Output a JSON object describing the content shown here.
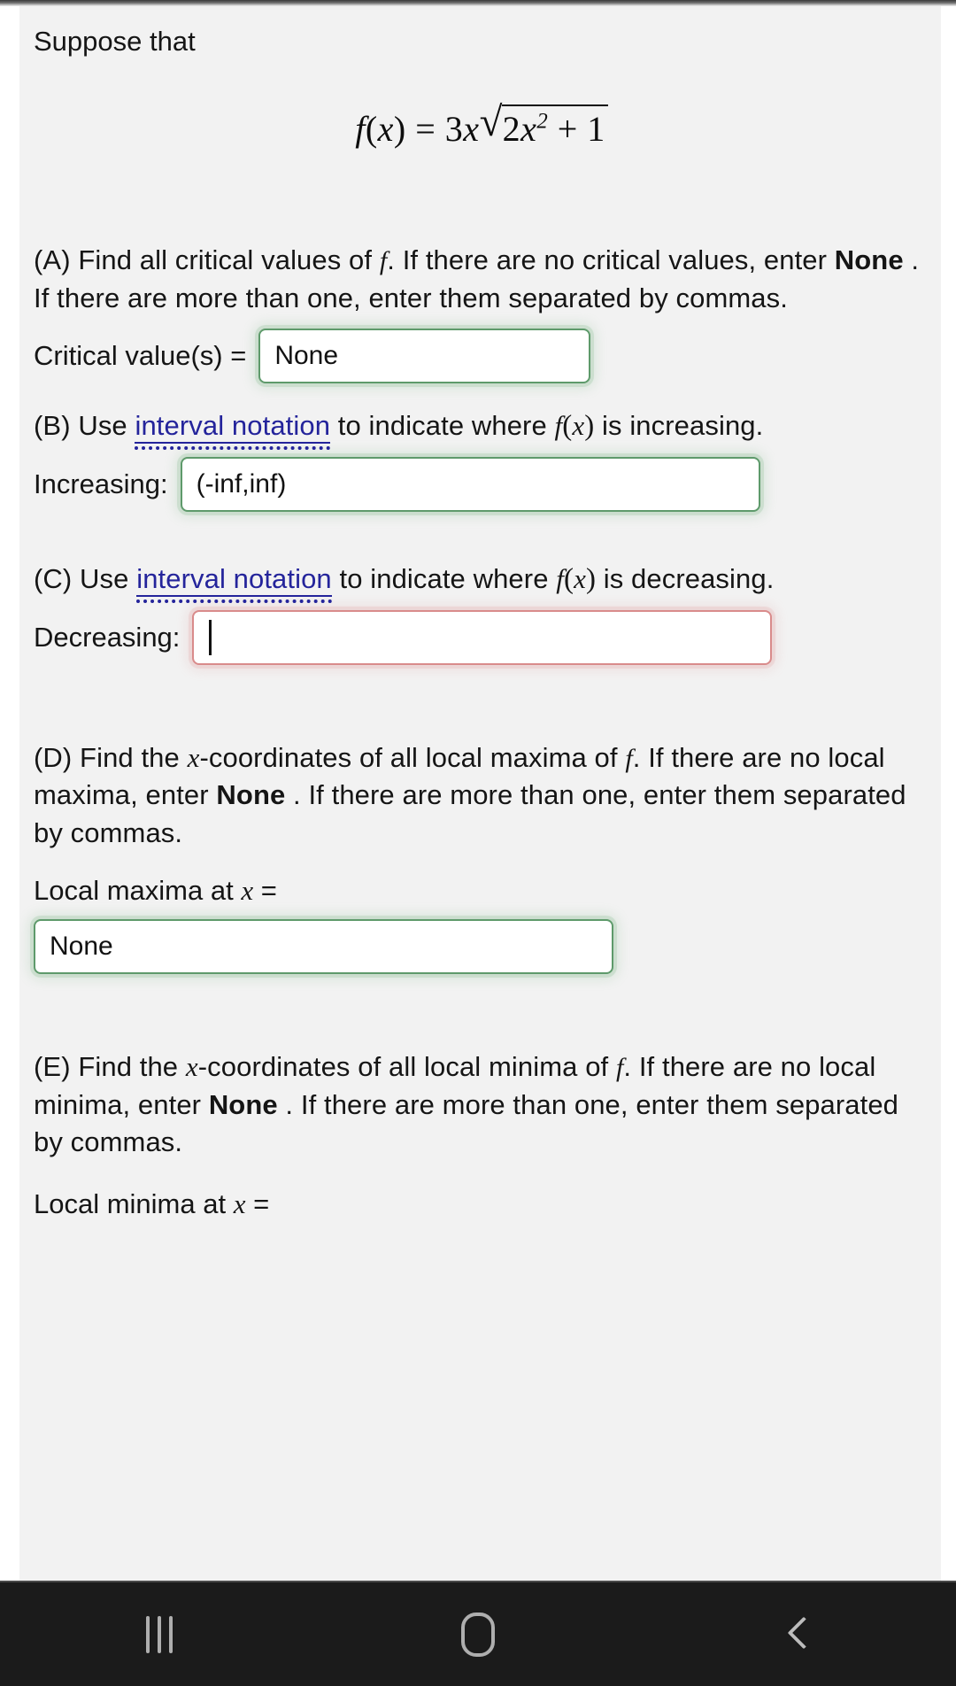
{
  "app": {
    "background_color": "#f2f2f2",
    "page_color": "#ffffff"
  },
  "problem": {
    "lead": "Suppose that",
    "equation_plain": "f(x) = 3x√(2x² + 1)",
    "equation_parts": {
      "f": "f",
      "lparen": "(",
      "x": "x",
      "rparen": ")",
      "equals": "=",
      "coefficient": "3",
      "coef_var": "x",
      "radical_sign": "√",
      "radicand_coef": "2",
      "radicand_var": "x",
      "radicand_exp": "2",
      "radicand_plus": "+",
      "radicand_const": "1"
    }
  },
  "parts": {
    "a": {
      "marker": "(A)",
      "text_1": " Find all critical values of ",
      "var_f": "f",
      "text_2": ". If there are no critical values, enter ",
      "bold_none": "None",
      "text_3": " . If there are more than one, enter them separated by commas.",
      "field_label": "Critical value(s) =",
      "field_value": "None",
      "field_state": "correct",
      "field_border_color": "#5e9a6b"
    },
    "b": {
      "marker": "(B)",
      "text_1": " Use ",
      "link": "interval notation",
      "link_color": "#24249b",
      "text_2": " to indicate where ",
      "fx": "f(x)",
      "text_3": " is increasing.",
      "field_label": "Increasing:",
      "field_value": "(-inf,inf)",
      "field_state": "correct",
      "field_border_color": "#5e9a6b"
    },
    "c": {
      "marker": "(C)",
      "text_1": " Use ",
      "link": "interval notation",
      "link_color": "#24249b",
      "text_2": " to indicate where ",
      "fx": "f(x)",
      "text_3": " is decreasing.",
      "field_label": "Decreasing:",
      "field_value": "",
      "field_state": "incorrect",
      "field_border_color": "#d98b8b",
      "has_text_cursor": true
    },
    "d": {
      "marker": "(D)",
      "text_1": " Find the ",
      "var_x": "x",
      "text_2": "-coordinates of all local maxima of ",
      "var_f": "f",
      "text_3": ". If there are no local maxima, enter ",
      "bold_none": "None",
      "text_4": " . If there are more than one, enter them separated by commas.",
      "field_label_prefix": "Local maxima at ",
      "field_label_var": "x",
      "field_label_suffix": " =",
      "field_value": "None",
      "field_state": "correct",
      "field_border_color": "#5e9a6b"
    },
    "e": {
      "marker": "(E)",
      "text_1": " Find the ",
      "var_x": "x",
      "text_2": "-coordinates of all local minima of ",
      "var_f": "f",
      "text_3": ". If there are no local minima, enter ",
      "bold_none": "None",
      "text_4": " . If there are more than one, enter them separated by commas.",
      "field_label_prefix": "Local minima at ",
      "field_label_var": "x",
      "field_label_suffix": " =",
      "cut_off": true
    }
  },
  "navbar": {
    "recents_label": "Recents",
    "home_label": "Home",
    "back_label": "Back",
    "icon_color": "#aeaeae",
    "background": "#1b1b1b"
  }
}
